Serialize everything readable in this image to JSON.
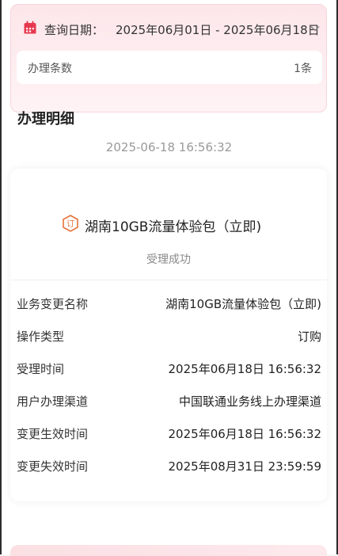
{
  "query": {
    "label": "查询日期：",
    "range": "2025年06月01日 - 2025年06月18日",
    "count_label": "办理条数",
    "count_value": "1条"
  },
  "section": {
    "title": "办理明细"
  },
  "record": {
    "timestamp": "2025-06-18 16:56:32",
    "package_name": "湖南10GB流量体验包（立即)",
    "status": "受理成功",
    "rows": [
      {
        "label": "业务变更名称",
        "value": "湖南10GB流量体验包（立即)"
      },
      {
        "label": "操作类型",
        "value": "订购"
      },
      {
        "label": "受理时间",
        "value": "2025年06月18日 16:56:32"
      },
      {
        "label": "用户办理渠道",
        "value": "中国联通业务线上办理渠道"
      },
      {
        "label": "变更生效时间",
        "value": "2025年06月18日 16:56:32"
      },
      {
        "label": "变更失效时间",
        "value": "2025年08月31日 23:59:59"
      }
    ]
  },
  "icons": {
    "calendar": "calendar-icon",
    "chevron": "chevron-down-icon",
    "package_badge": "subscribe-badge-icon"
  },
  "colors": {
    "accent": "#e8384f",
    "badge": "#e6733a"
  }
}
